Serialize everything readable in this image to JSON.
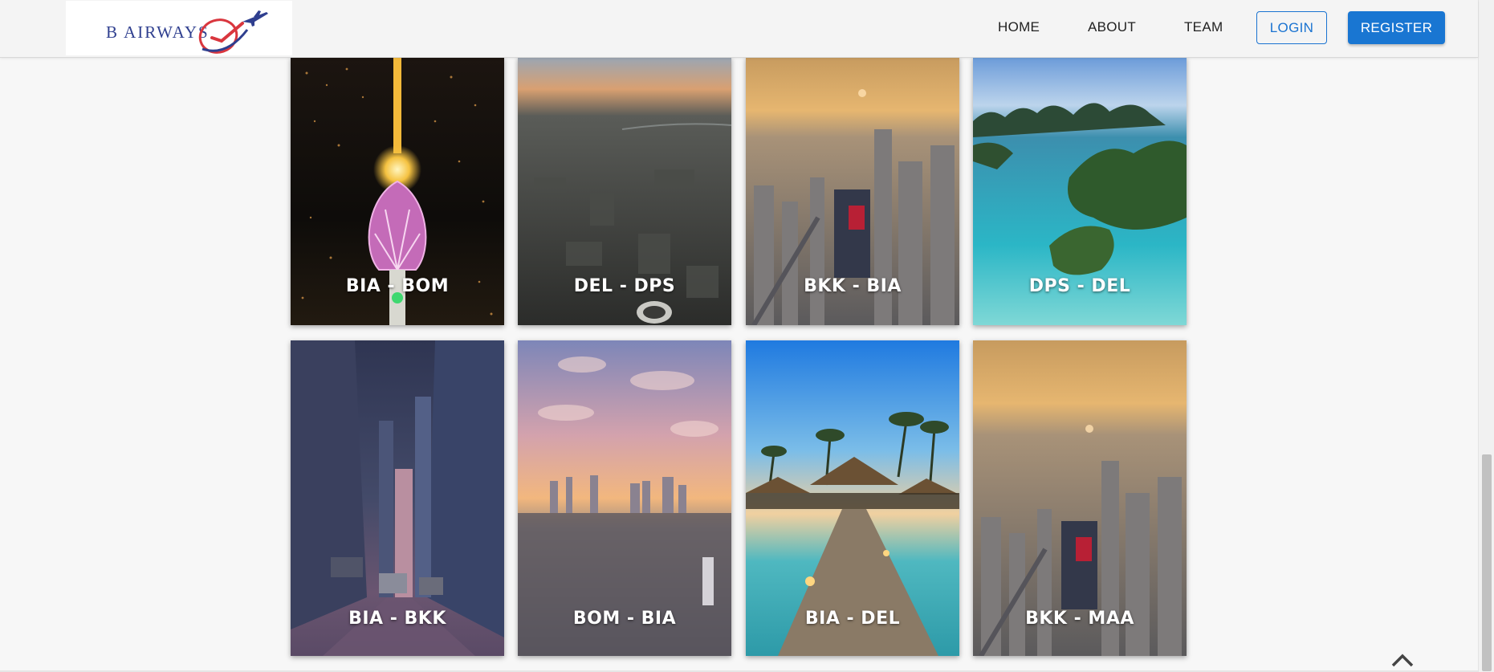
{
  "brand": {
    "name": "B AIRWAYS",
    "logo_icon": "plane-swoosh-logo-icon"
  },
  "nav": {
    "home": "HOME",
    "about": "ABOUT",
    "team": "TEAM"
  },
  "auth": {
    "login": "LOGIN",
    "register": "REGISTER"
  },
  "colors": {
    "accent": "#1976d2",
    "brand_text": "#2f3f8f",
    "logo_red": "#d9363e"
  },
  "routes": [
    {
      "label": "BIA - BOM",
      "scene": "night-lotus-tower"
    },
    {
      "label": "DEL - DPS",
      "scene": "aerial-city-dusk"
    },
    {
      "label": "BKK - BIA",
      "scene": "city-skyline-sunset"
    },
    {
      "label": "DPS - DEL",
      "scene": "tropical-islands"
    },
    {
      "label": "BIA - BKK",
      "scene": "city-street-skyscrapers"
    },
    {
      "label": "BOM - BIA",
      "scene": "city-sunset-clouds"
    },
    {
      "label": "BIA - DEL",
      "scene": "beach-resort-pier"
    },
    {
      "label": "BKK - MAA",
      "scene": "city-skyline-sunset"
    }
  ],
  "scroll_top_icon": "chevron-up-icon"
}
